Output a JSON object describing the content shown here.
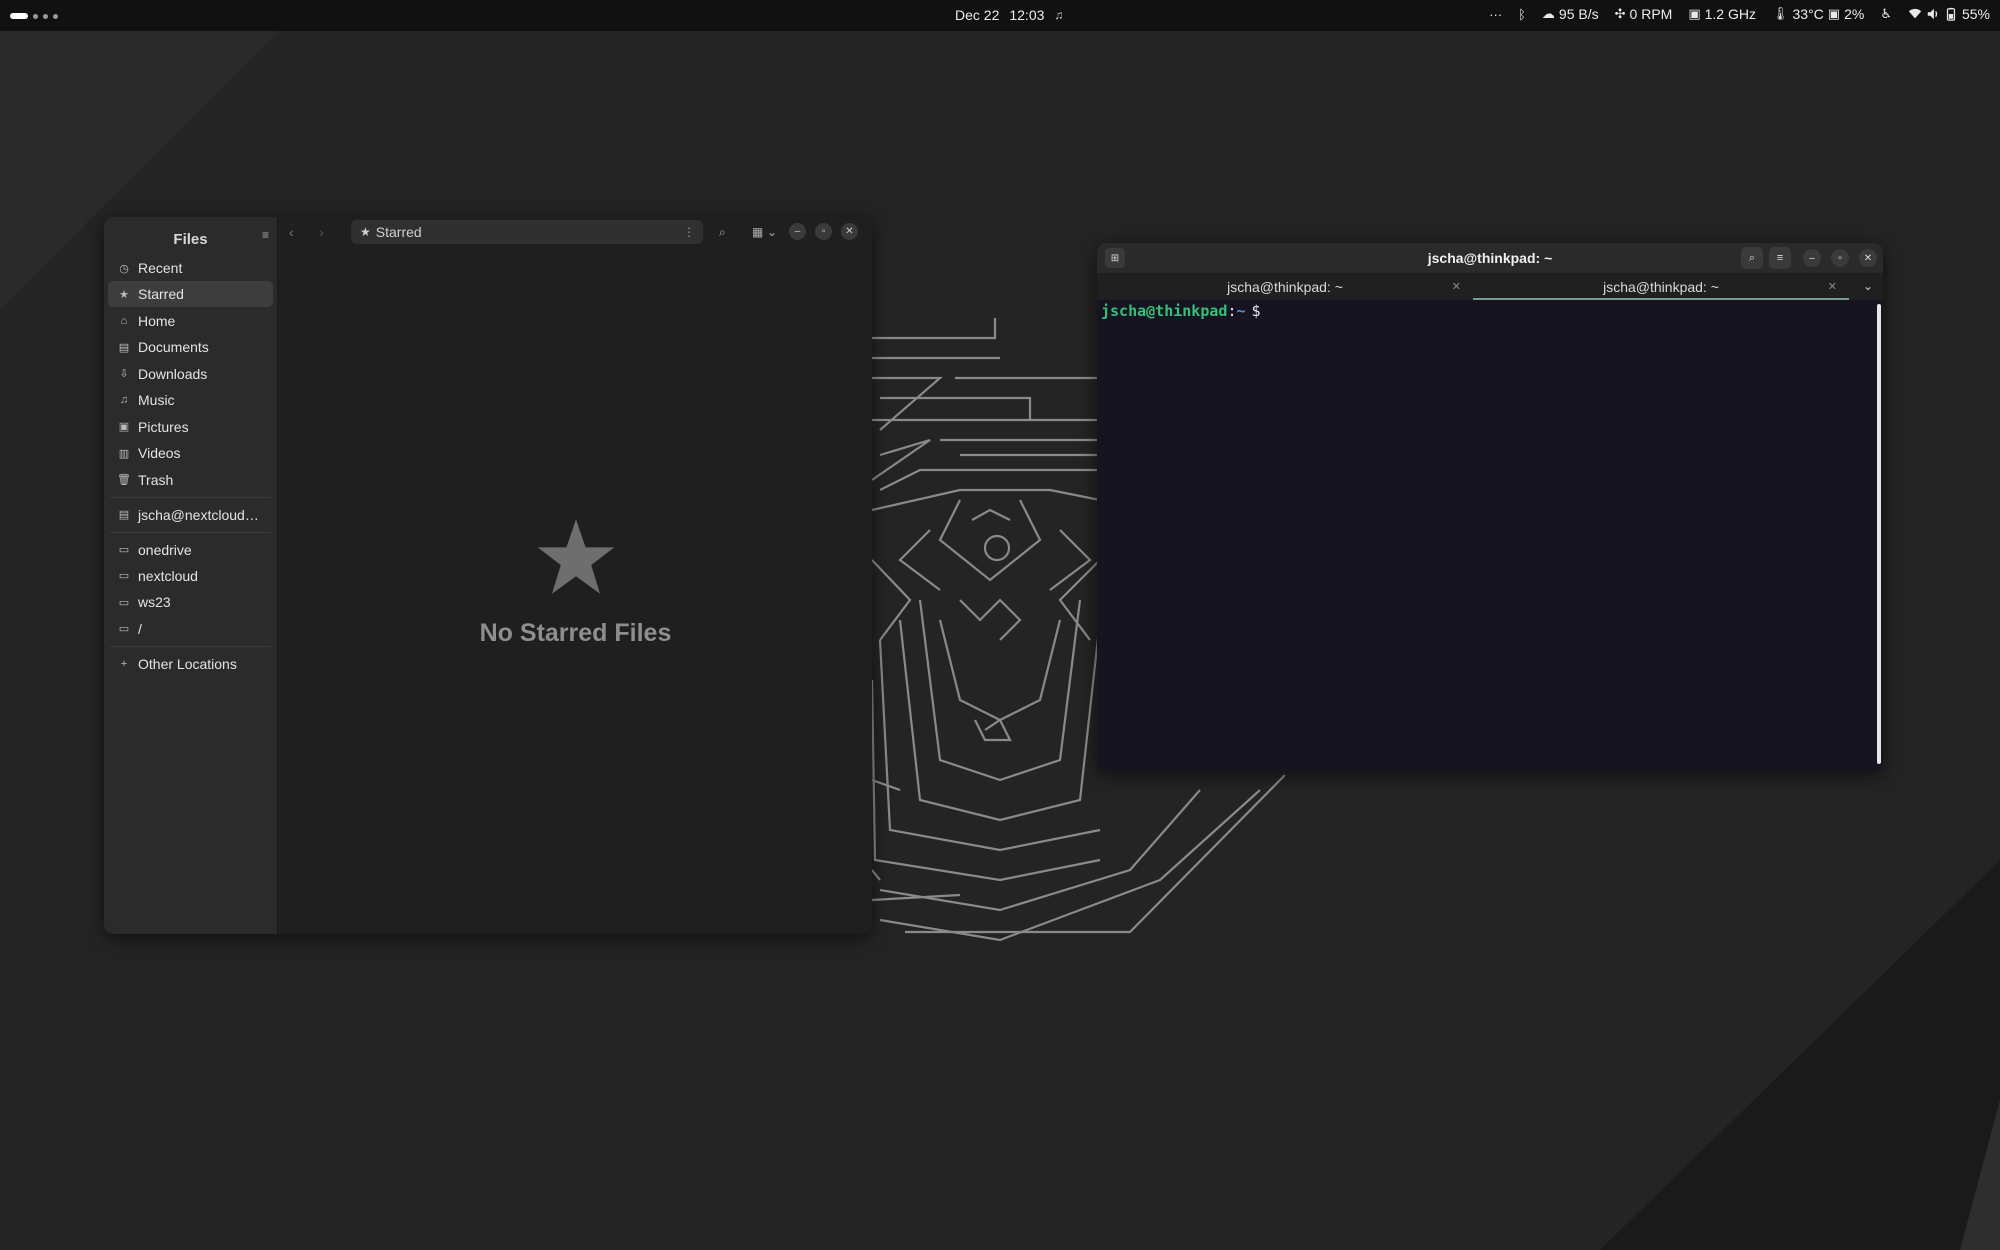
{
  "topbar": {
    "date": "Dec 22",
    "time": "12:03",
    "net_speed": "95 B/s",
    "fan": "0 RPM",
    "cpu_freq": "1.2 GHz",
    "temp": "33°C",
    "cpu_load": "2%",
    "battery": "55%",
    "more": "···"
  },
  "files": {
    "title": "Files",
    "sidebar": {
      "places": [
        {
          "label": "Recent",
          "icon": "clock-icon"
        },
        {
          "label": "Starred",
          "icon": "star-icon"
        },
        {
          "label": "Home",
          "icon": "home-icon"
        },
        {
          "label": "Documents",
          "icon": "document-icon"
        },
        {
          "label": "Downloads",
          "icon": "download-icon"
        },
        {
          "label": "Music",
          "icon": "music-icon"
        },
        {
          "label": "Pictures",
          "icon": "picture-icon"
        },
        {
          "label": "Videos",
          "icon": "video-icon"
        },
        {
          "label": "Trash",
          "icon": "trash-icon"
        }
      ],
      "network": [
        {
          "label": "jscha@nextcloud…",
          "icon": "server-icon"
        }
      ],
      "bookmarks": [
        {
          "label": "onedrive",
          "icon": "folder-icon"
        },
        {
          "label": "nextcloud",
          "icon": "folder-icon"
        },
        {
          "label": "ws23",
          "icon": "folder-icon"
        },
        {
          "label": "/",
          "icon": "folder-icon"
        }
      ],
      "other": {
        "label": "Other Locations",
        "icon": "plus-icon"
      }
    },
    "pathbar": {
      "location": "Starred"
    },
    "empty_title": "No Starred Files"
  },
  "terminal": {
    "title": "jscha@thinkpad: ~",
    "tabs": [
      {
        "label": "jscha@thinkpad: ~"
      },
      {
        "label": "jscha@thinkpad: ~"
      }
    ],
    "prompt": {
      "user": "jscha@thinkpad",
      "sep": ":",
      "path": "~",
      "dollar": "$"
    }
  },
  "colors": {
    "prompt_user": "#33c27a",
    "prompt_path": "#5a8fd6",
    "terminal_bg": "#161421",
    "topbar_bg": "#111111"
  }
}
